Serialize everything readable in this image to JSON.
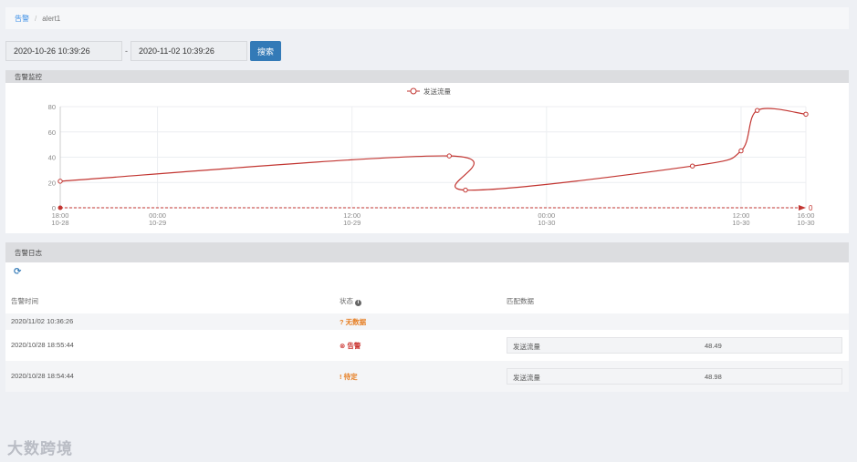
{
  "breadcrumb": {
    "root": "告警",
    "sep": "/",
    "current": "alert1"
  },
  "date_range": {
    "start": "2020-10-26 10:39:26",
    "dash": "-",
    "end": "2020-11-02 10:39:26",
    "search_label": "搜索"
  },
  "monitor": {
    "title": "告警监控",
    "chart_data": {
      "type": "line",
      "title": "",
      "series": [
        {
          "name": "发送流量",
          "color": "#c23531",
          "points": [
            {
              "x": "10-28 18:00",
              "y": 21
            },
            {
              "x": "10-29 18:00",
              "y": 41
            },
            {
              "x": "10-29 19:00",
              "y": 14
            },
            {
              "x": "10-30 09:00",
              "y": 33
            },
            {
              "x": "10-30 12:00",
              "y": 45
            },
            {
              "x": "10-30 13:00",
              "y": 77
            },
            {
              "x": "10-30 16:00",
              "y": 74
            }
          ]
        }
      ],
      "threshold": {
        "value": 0,
        "color": "#c23531",
        "label": "0"
      },
      "ylim": [
        0,
        80
      ],
      "yticks": [
        0,
        20,
        40,
        60,
        80
      ],
      "xticks": [
        {
          "time": "18:00",
          "date": "10-28"
        },
        {
          "time": "00:00",
          "date": "10-29"
        },
        {
          "time": "12:00",
          "date": "10-29"
        },
        {
          "time": "00:00",
          "date": "10-30"
        },
        {
          "time": "12:00",
          "date": "10-30"
        },
        {
          "time": "16:00",
          "date": "10-30"
        }
      ],
      "legend_position": "top-center",
      "grid": true
    }
  },
  "log": {
    "title": "告警日志",
    "refresh_icon": "refresh-icon",
    "columns": {
      "time": "告警时间",
      "status": "状态",
      "match": "匹配数据"
    },
    "rows": [
      {
        "time": "2020/11/02 10:36:26",
        "status_icon": "?",
        "status": "无数据",
        "status_color": "#e67e22",
        "match_key": "",
        "match_value": ""
      },
      {
        "time": "2020/10/28 18:55:44",
        "status_icon": "⊗",
        "status": "告警",
        "status_color": "#c9302c",
        "match_key": "发送流量",
        "match_value": "48.49"
      },
      {
        "time": "2020/10/28 18:54:44",
        "status_icon": "!",
        "status": "待定",
        "status_color": "#e67e22",
        "match_key": "发送流量",
        "match_value": "48.98"
      }
    ]
  },
  "watermark": "大数跨境"
}
